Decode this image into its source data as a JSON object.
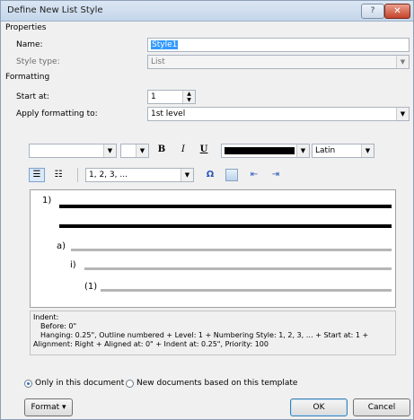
{
  "window": {
    "title": "Define New List Style",
    "help_glyph": "?",
    "close_glyph": "✕"
  },
  "properties": {
    "section": "Properties",
    "name_label": "Name:",
    "name_value": "Style1",
    "style_type_label": "Style type:",
    "style_type_value": "List"
  },
  "formatting": {
    "section": "Formatting",
    "start_at_label": "Start at:",
    "start_at_value": "1",
    "apply_label": "Apply formatting to:",
    "apply_value": "1st level",
    "font_value": "",
    "size_value": "",
    "bold": "B",
    "italic": "I",
    "underline": "U",
    "color": "#000000",
    "language": "Latin"
  },
  "numbering": {
    "style_value": "1, 2, 3, ...",
    "symbol_glyph": "Ω"
  },
  "preview": {
    "level1": "1)",
    "level2": "a)",
    "level3": "i)",
    "level4": "(1)"
  },
  "description": {
    "line1": "Indent:",
    "line2": "Before:  0\"",
    "line3": "Hanging:  0.25\", Outline numbered + Level: 1 + Numbering Style: 1, 2, 3, … + Start at: 1 +",
    "line4": "Alignment: Right + Aligned at:  0\" + Indent at:  0.25\", Priority: 100"
  },
  "scope": {
    "only_doc": "Only in this document",
    "new_docs": "New documents based on this template",
    "selected": "only_doc"
  },
  "buttons": {
    "format": "Format ▾",
    "ok": "OK",
    "cancel": "Cancel"
  }
}
